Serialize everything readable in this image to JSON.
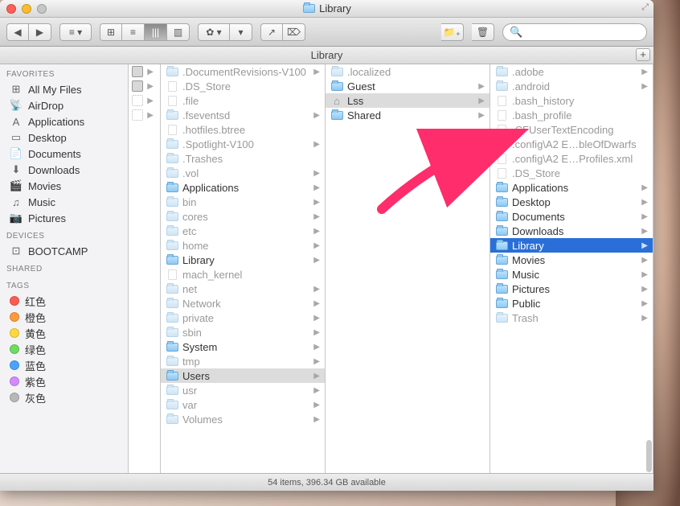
{
  "window": {
    "title": "Library",
    "fullscreen_hint": "⤢"
  },
  "toolbar": {
    "nav_back": "◀",
    "nav_fwd": "▶",
    "menu": "≡ ▾",
    "view_icons": "⊞",
    "view_list": "≡",
    "view_columns": "|||",
    "view_cover": "▥",
    "action": "✿ ▾",
    "actionmenu": "▾",
    "share": "↗",
    "edit": "⌦",
    "newfolder": "📁₊",
    "trash": "🗑",
    "search_icon": "🔍",
    "search_placeholder": ""
  },
  "pathbar": {
    "label": "Library",
    "plus": "+"
  },
  "sidebar": {
    "sections": [
      {
        "head": "Favorites",
        "items": [
          {
            "icon": "⊞",
            "label": "All My Files"
          },
          {
            "icon": "📡",
            "label": "AirDrop"
          },
          {
            "icon": "A",
            "label": "Applications"
          },
          {
            "icon": "▭",
            "label": "Desktop"
          },
          {
            "icon": "📄",
            "label": "Documents"
          },
          {
            "icon": "⬇",
            "label": "Downloads"
          },
          {
            "icon": "🎬",
            "label": "Movies"
          },
          {
            "icon": "♫",
            "label": "Music"
          },
          {
            "icon": "📷",
            "label": "Pictures"
          }
        ]
      },
      {
        "head": "Devices",
        "items": [
          {
            "icon": "⊡",
            "label": "BOOTCAMP"
          }
        ]
      },
      {
        "head": "Shared",
        "items": []
      },
      {
        "head": "Tags",
        "items": [
          {
            "color": "#ff5b50",
            "label": "红色"
          },
          {
            "color": "#ff9a3c",
            "label": "橙色"
          },
          {
            "color": "#ffd93c",
            "label": "黄色"
          },
          {
            "color": "#6edc5f",
            "label": "绿色"
          },
          {
            "color": "#4aa3ff",
            "label": "蓝色"
          },
          {
            "color": "#d48bff",
            "label": "紫色"
          },
          {
            "color": "#b8b8b8",
            "label": "灰色"
          }
        ]
      }
    ]
  },
  "columns": {
    "c1": [
      {
        "t": "hd",
        "arrow": true
      },
      {
        "t": "hd",
        "arrow": true
      },
      {
        "t": "ghost",
        "arrow": true
      },
      {
        "t": "ghost",
        "arrow": true
      }
    ],
    "c2": [
      {
        "t": "folder",
        "dim": true,
        "label": ".DocumentRevisions-V100",
        "arrow": true
      },
      {
        "t": "file",
        "dim": true,
        "label": ".DS_Store"
      },
      {
        "t": "file",
        "dim": true,
        "label": ".file"
      },
      {
        "t": "folder",
        "dim": true,
        "label": ".fseventsd",
        "arrow": true
      },
      {
        "t": "file",
        "dim": true,
        "label": ".hotfiles.btree"
      },
      {
        "t": "folder",
        "dim": true,
        "label": ".Spotlight-V100",
        "arrow": true
      },
      {
        "t": "folder",
        "dim": true,
        "label": ".Trashes"
      },
      {
        "t": "folder",
        "dim": true,
        "label": ".vol",
        "arrow": true
      },
      {
        "t": "folder",
        "label": "Applications",
        "arrow": true
      },
      {
        "t": "folder",
        "dim": true,
        "label": "bin",
        "arrow": true
      },
      {
        "t": "folder",
        "dim": true,
        "label": "cores",
        "arrow": true
      },
      {
        "t": "folder",
        "dim": true,
        "label": "etc",
        "arrow": true
      },
      {
        "t": "folder",
        "dim": true,
        "label": "home",
        "arrow": true
      },
      {
        "t": "folder",
        "label": "Library",
        "arrow": true
      },
      {
        "t": "file",
        "dim": true,
        "label": "mach_kernel"
      },
      {
        "t": "folder",
        "dim": true,
        "label": "net",
        "arrow": true
      },
      {
        "t": "folder",
        "dim": true,
        "label": "Network",
        "arrow": true
      },
      {
        "t": "folder",
        "dim": true,
        "label": "private",
        "arrow": true
      },
      {
        "t": "folder",
        "dim": true,
        "label": "sbin",
        "arrow": true
      },
      {
        "t": "folder",
        "label": "System",
        "arrow": true
      },
      {
        "t": "folder",
        "dim": true,
        "label": "tmp",
        "arrow": true
      },
      {
        "t": "folder",
        "label": "Users",
        "arrow": true,
        "sel": true
      },
      {
        "t": "folder",
        "dim": true,
        "label": "usr",
        "arrow": true
      },
      {
        "t": "folder",
        "dim": true,
        "label": "var",
        "arrow": true
      },
      {
        "t": "folder",
        "dim": true,
        "label": "Volumes",
        "arrow": true
      }
    ],
    "c3": [
      {
        "t": "folder",
        "dim": true,
        "label": ".localized"
      },
      {
        "t": "folder",
        "label": "Guest",
        "arrow": true
      },
      {
        "t": "house",
        "label": "Lss",
        "arrow": true,
        "sel": true
      },
      {
        "t": "folder",
        "label": "Shared",
        "arrow": true
      }
    ],
    "c4": [
      {
        "t": "folder",
        "dim": true,
        "label": ".adobe",
        "arrow": true
      },
      {
        "t": "folder",
        "dim": true,
        "label": ".android",
        "arrow": true
      },
      {
        "t": "file",
        "dim": true,
        "label": ".bash_history"
      },
      {
        "t": "file",
        "dim": true,
        "label": ".bash_profile"
      },
      {
        "t": "file",
        "dim": true,
        "label": ".CFUserTextEncoding"
      },
      {
        "t": "file",
        "dim": true,
        "label": ".config\\A2 E…bleOfDwarfs"
      },
      {
        "t": "file",
        "dim": true,
        "label": ".config\\A2 E…Profiles.xml"
      },
      {
        "t": "file",
        "dim": true,
        "label": ".DS_Store"
      },
      {
        "t": "folder",
        "label": "Applications",
        "arrow": true
      },
      {
        "t": "folder",
        "label": "Desktop",
        "arrow": true
      },
      {
        "t": "folder",
        "label": "Documents",
        "arrow": true
      },
      {
        "t": "folder",
        "label": "Downloads",
        "arrow": true
      },
      {
        "t": "folder",
        "label": "Library",
        "arrow": true,
        "active": true
      },
      {
        "t": "folder",
        "label": "Movies",
        "arrow": true
      },
      {
        "t": "folder",
        "label": "Music",
        "arrow": true
      },
      {
        "t": "folder",
        "label": "Pictures",
        "arrow": true
      },
      {
        "t": "folder",
        "label": "Public",
        "arrow": true
      },
      {
        "t": "folder",
        "dim": true,
        "label": "Trash",
        "arrow": true
      }
    ]
  },
  "status": {
    "text": "54 items, 396.34 GB available"
  }
}
